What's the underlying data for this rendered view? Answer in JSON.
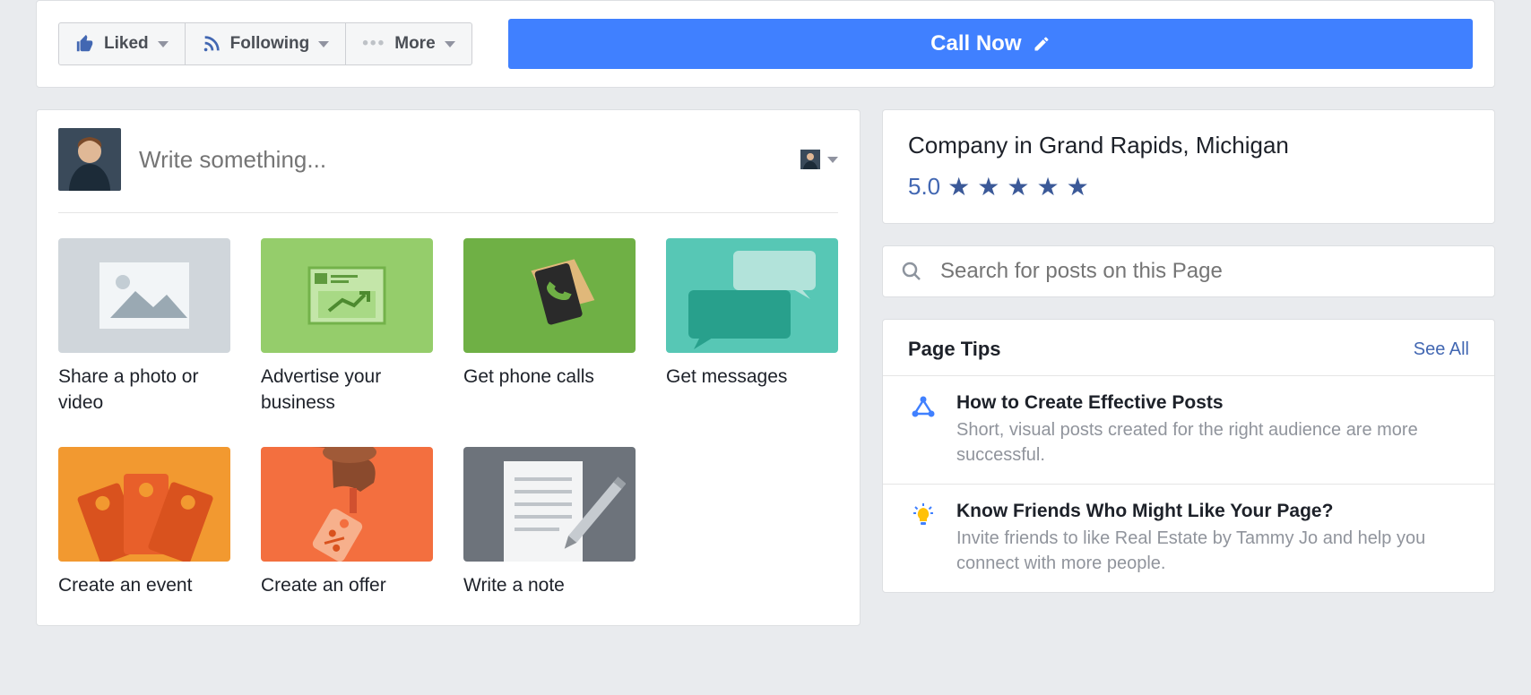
{
  "toolbar": {
    "liked_label": "Liked",
    "following_label": "Following",
    "more_label": "More"
  },
  "cta": {
    "label": "Call Now"
  },
  "composer": {
    "placeholder": "Write something..."
  },
  "tiles": [
    {
      "label": "Share a photo or video"
    },
    {
      "label": "Advertise your business"
    },
    {
      "label": "Get phone calls"
    },
    {
      "label": "Get messages"
    },
    {
      "label": "Create an event"
    },
    {
      "label": "Create an offer"
    },
    {
      "label": "Write a note"
    }
  ],
  "business": {
    "title": "Company in Grand Rapids, Michigan",
    "rating_value": "5.0",
    "rating_stars": 5
  },
  "search": {
    "placeholder": "Search for posts on this Page"
  },
  "page_tips": {
    "heading": "Page Tips",
    "see_all": "See All",
    "items": [
      {
        "title": "How to Create Effective Posts",
        "desc": "Short, visual posts created for the right audience are more successful."
      },
      {
        "title": "Know Friends Who Might Like Your Page?",
        "desc": "Invite friends to like Real Estate by Tammy Jo and help you connect with more people."
      }
    ]
  }
}
